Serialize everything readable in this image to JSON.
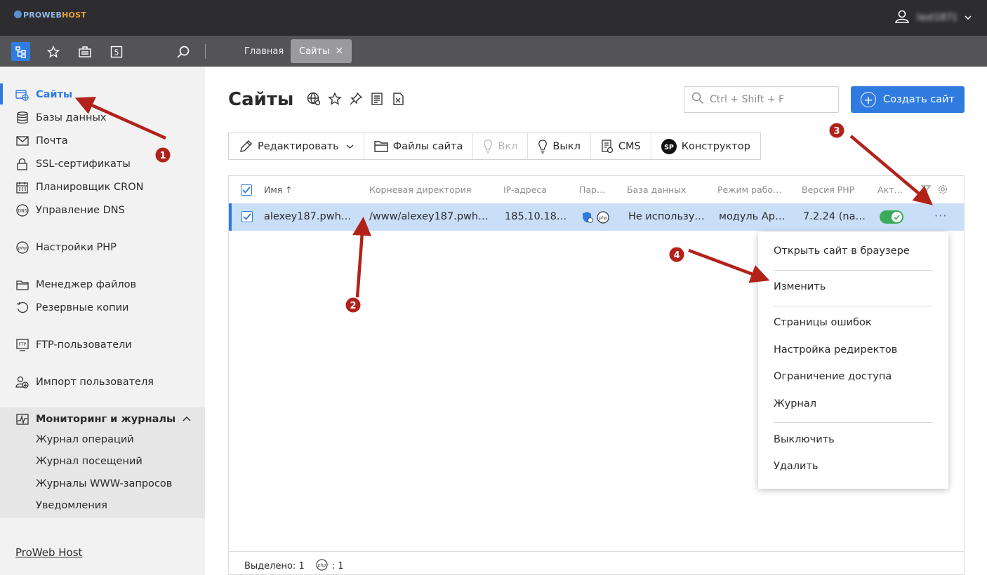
{
  "brand": {
    "logo_left": "PROWEB",
    "logo_right": "HOST"
  },
  "user": {
    "name": "test1871"
  },
  "top_tabs": [
    {
      "label": "Главная"
    },
    {
      "label": "Сайты",
      "close": "✕"
    }
  ],
  "sidebar": {
    "items": [
      {
        "label": "Сайты",
        "icon": "sites-icon"
      },
      {
        "label": "Базы данных",
        "icon": "database-icon"
      },
      {
        "label": "Почта",
        "icon": "mail-icon"
      },
      {
        "label": "SSL-сертификаты",
        "icon": "lock-icon"
      },
      {
        "label": "Планировщик CRON",
        "icon": "calendar-icon"
      },
      {
        "label": "Управление DNS",
        "icon": "dns-icon"
      },
      {
        "label": "Настройки PHP",
        "icon": "php-icon"
      },
      {
        "label": "Менеджер файлов",
        "icon": "folder-icon"
      },
      {
        "label": "Резервные копии",
        "icon": "backup-icon"
      },
      {
        "label": "FTP-пользователи",
        "icon": "ftp-icon"
      },
      {
        "label": "Импорт пользователя",
        "icon": "import-user-icon"
      }
    ],
    "group": {
      "label": "Мониторинг и журналы",
      "icon": "monitoring-icon",
      "items": [
        "Журнал операций",
        "Журнал посещений",
        "Журналы WWW-запросов",
        "Уведомления"
      ]
    },
    "footer_link": "ProWeb Host"
  },
  "page": {
    "title": "Сайты"
  },
  "search": {
    "placeholder": "Ctrl + Shift + F"
  },
  "create_button": {
    "label": "Создать сайт"
  },
  "actions": {
    "edit": "Редактировать",
    "files": "Файлы сайта",
    "on": "Вкл",
    "off": "Выкл",
    "cms": "CMS",
    "builder": "Конструктор",
    "builder_badge": "SP"
  },
  "table": {
    "headers": [
      "Имя ↑",
      "Корневая директория",
      "IP-адреса",
      "Пар…",
      "База данных",
      "Режим рабо…",
      "Версия PHP",
      "Акт…"
    ],
    "rows": [
      {
        "name": "alexey187.pwh…",
        "root": "/www/alexey187.pwh…",
        "ip": "185.10.18…",
        "db": "Не использу…",
        "mode": "модуль Ap…",
        "php": "7.2.24 (na…",
        "active": true
      }
    ],
    "status": {
      "selected": "Выделено: 1",
      "php_count": ": 1"
    }
  },
  "context_menu": {
    "items": [
      "Открыть сайт в браузере",
      "Изменить",
      "Страницы ошибок",
      "Настройка редиректов",
      "Ограничение доступа",
      "Журнал",
      "Выключить",
      "Удалить"
    ]
  },
  "annotations": [
    "1",
    "2",
    "3",
    "4"
  ],
  "colors": {
    "accent": "#2f7be0",
    "topbar": "#2d2d2f",
    "toolbar": "#545457",
    "row_selected": "#c9dff8",
    "toggle_on": "#3bab5a",
    "arrow": "#b2221b"
  }
}
